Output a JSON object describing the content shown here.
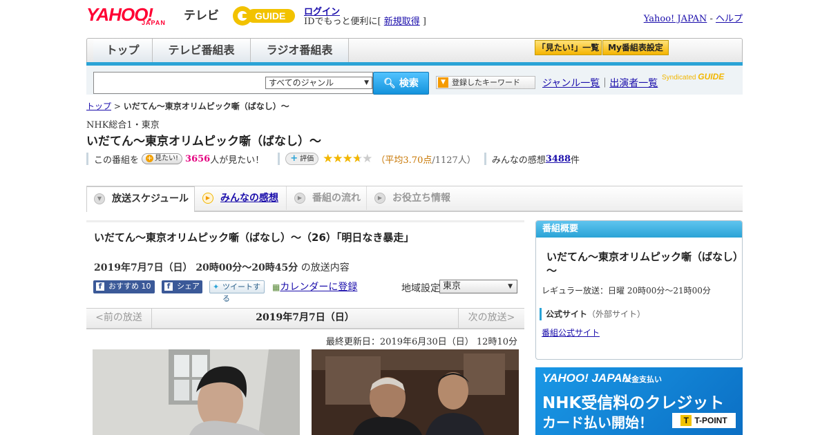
{
  "header": {
    "logo_yahoo": "YAHOO!",
    "logo_japan": "JAPAN",
    "logo_service": "テレビ",
    "gguide_logo": "GUIDE",
    "login": "ログイン",
    "login_sub_prefix": "IDでもっと便利に[ ",
    "signup": "新規取得",
    "login_sub_suffix": " ]",
    "yj_link": "Yahoo! JAPAN",
    "help_link": "ヘルプ",
    "separator": " - "
  },
  "nav": {
    "tabs": [
      "トップ",
      "テレビ番組表",
      "ラジオ番組表"
    ],
    "want_list": "「見たい!」一覧",
    "my_schedule": "My番組表設定"
  },
  "search": {
    "placeholder": "",
    "genre_selected": "すべてのジャンル",
    "button": "検索",
    "keyword_button": "登録したキーワード",
    "genre_list": "ジャンル一覧",
    "cast_list": "出演者一覧",
    "divider": "｜",
    "syndicated": "Syndicated"
  },
  "breadcrumb": {
    "top": "トップ",
    "sep": " > ",
    "current": "いだてん～東京オリムピック噺（ばなし）～"
  },
  "program": {
    "channel": "NHK総合1・東京",
    "title": "いだてん～東京オリムピック噺（ばなし）～",
    "want_prefix": "この番組を",
    "want_button": "見たい!",
    "want_count": "3656",
    "want_suffix": "人が見たい！",
    "rate_button": "評価",
    "rating_avg": "（平均3.70点",
    "rating_votes": "/1127人）",
    "rating_value": 3.7,
    "impressions_prefix": "みんなの感想 ",
    "impressions_count": "3488",
    "impressions_suffix": "件"
  },
  "tabs": [
    {
      "label": "放送スケジュール"
    },
    {
      "label": "みんなの感想"
    },
    {
      "label": "番組の流れ"
    },
    {
      "label": "お役立ち情報"
    }
  ],
  "episode": {
    "title": "いだてん～東京オリムピック噺（ばなし）～（26）「明日なき暴走」",
    "date_time": "2019年7月7日（日） 20時00分～20時45分",
    "date_suffix": " の放送内容",
    "fb_recommend": "おすすめ",
    "fb_count": "10",
    "fb_share": "シェア",
    "tweet": "ツイートする",
    "calendar": "カレンダーに登録",
    "area_label": "地域設定",
    "area_selected": "東京",
    "prev": "<前の放送",
    "current_date": "2019年7月7日（日）",
    "next": "次の放送>",
    "updated": "最終更新日：2019年6月30日（日） 12時10分"
  },
  "sidebar": {
    "heading": "番組概要",
    "title": "いだてん～東京オリムピック噺（ばなし）～",
    "regular": "レギュラー放送：日曜 20時00分～21時00分",
    "official_label": "公式サイト",
    "official_note": "（外部サイト）",
    "official_link": "番組公式サイト"
  },
  "ad": {
    "logo": "YAHOO! JAPAN",
    "sub": "公金支払い",
    "line1": "NHK受信料のクレジット",
    "line2": "カード払い開始！",
    "tpoint": "T-POINT",
    "tpoint_mark": "T"
  },
  "colors": {
    "accent_blue": "#2aa3d6",
    "yahoo_red": "#ff0033",
    "star_gold": "#f2b600",
    "pink": "#e4007f"
  }
}
